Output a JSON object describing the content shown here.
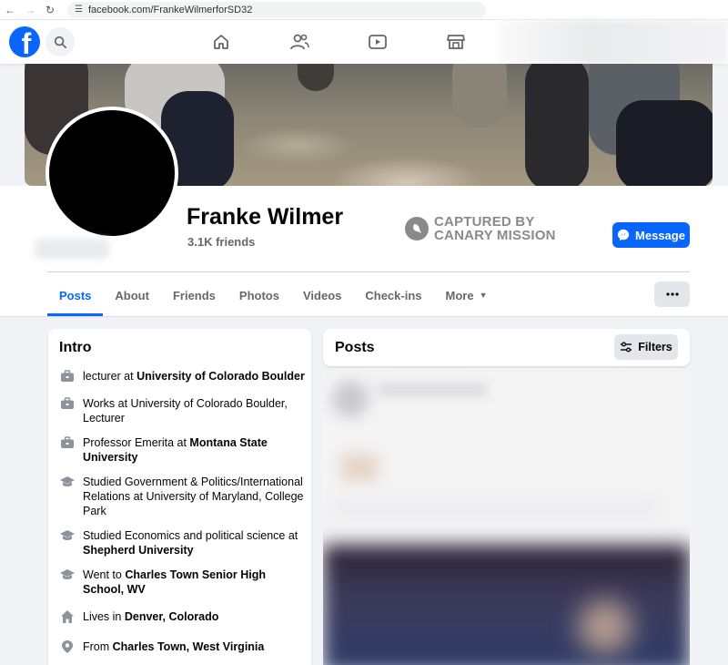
{
  "browser": {
    "url": "facebook.com/FrankeWilmerforSD32"
  },
  "topnav": {
    "logo_letter": "f",
    "icons": [
      "home-icon",
      "friends-icon",
      "video-icon",
      "marketplace-icon"
    ]
  },
  "profile": {
    "name": "Franke Wilmer",
    "friends": "3.1K friends",
    "message_label": "Message"
  },
  "watermark": {
    "line1": "CAPTURED BY",
    "line2": "CANARY MISSION"
  },
  "tabs": [
    {
      "label": "Posts",
      "active": true
    },
    {
      "label": "About"
    },
    {
      "label": "Friends"
    },
    {
      "label": "Photos"
    },
    {
      "label": "Videos"
    },
    {
      "label": "Check-ins"
    },
    {
      "label": "More"
    }
  ],
  "intro": {
    "title": "Intro",
    "items": [
      {
        "icon": "briefcase-icon",
        "pre": "lecturer at ",
        "bold": "University of Colorado Boulder",
        "post": ""
      },
      {
        "icon": "briefcase-icon",
        "pre": "Works at University of Colorado Boulder, Lecturer",
        "bold": "",
        "post": ""
      },
      {
        "icon": "briefcase-icon",
        "pre": "Professor Emerita at ",
        "bold": "Montana State University",
        "post": ""
      },
      {
        "icon": "graduation-cap-icon",
        "pre": "Studied Government & Politics/International Relations at University of Maryland, College Park",
        "bold": "",
        "post": ""
      },
      {
        "icon": "graduation-cap-icon",
        "pre": "Studied Economics and political science at ",
        "bold": "Shepherd University",
        "post": ""
      },
      {
        "icon": "graduation-cap-icon",
        "pre": "Went to ",
        "bold": "Charles Town Senior High School, WV",
        "post": ""
      },
      {
        "icon": "home-icon",
        "pre": "Lives in ",
        "bold": "Denver, Colorado",
        "post": ""
      },
      {
        "icon": "location-pin-icon",
        "pre": "From ",
        "bold": "Charles Town, West Virginia",
        "post": ""
      }
    ]
  },
  "posts": {
    "title": "Posts",
    "filters_label": "Filters"
  },
  "colors": {
    "brand": "#0866ff",
    "secondary_text": "#65676b"
  }
}
